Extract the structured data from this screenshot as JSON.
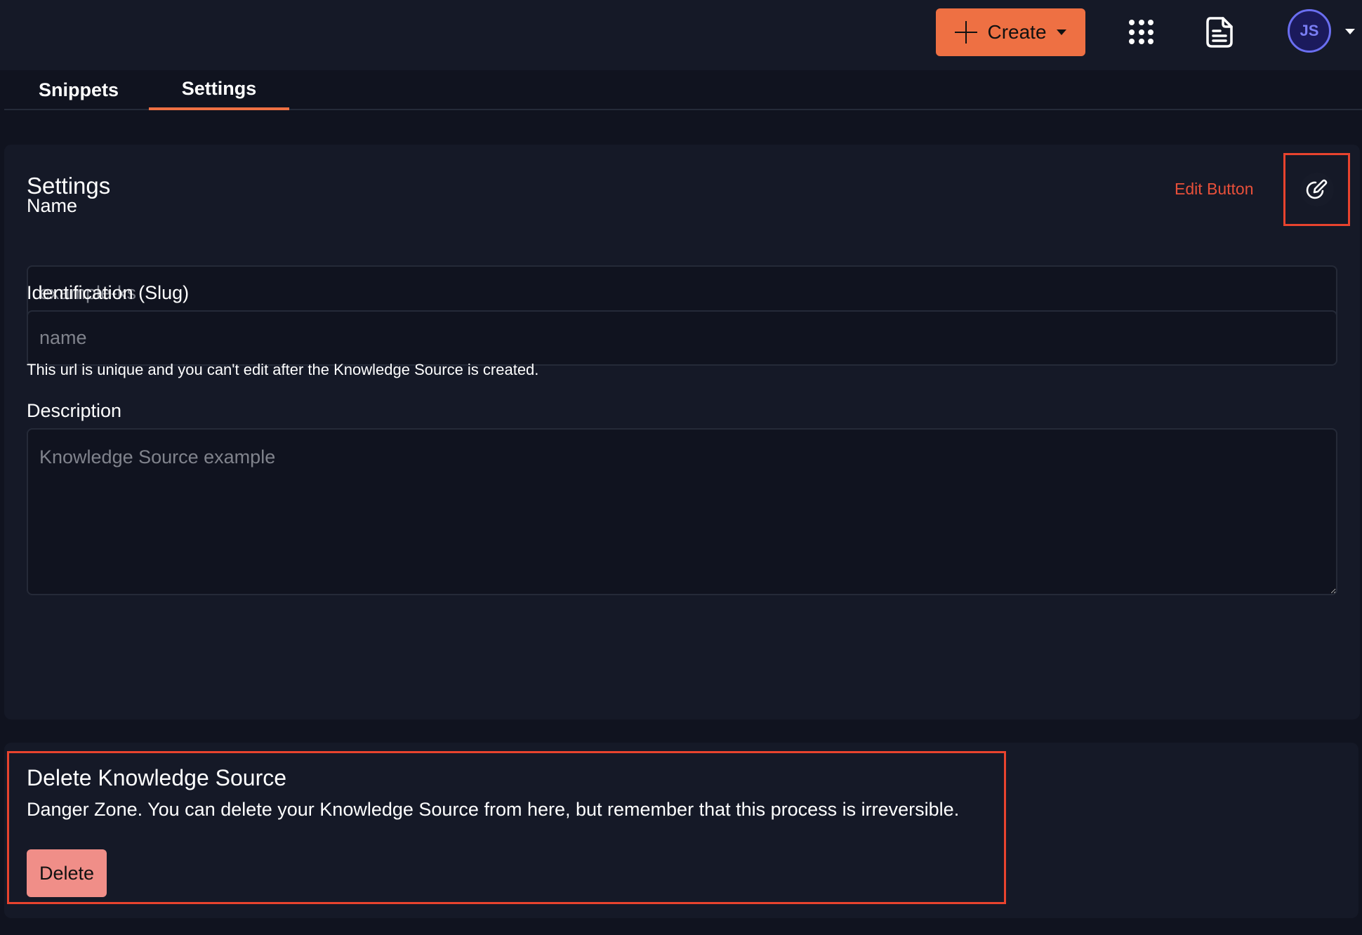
{
  "header": {
    "create_label": "Create",
    "avatar_initials": "JS",
    "icons": {
      "create": "plus-icon",
      "create_dropdown": "caret-down-icon",
      "apps": "apps-grid-icon",
      "docs": "document-icon",
      "user_menu": "caret-down-icon"
    }
  },
  "tabs": [
    {
      "label": "Snippets",
      "active": false
    },
    {
      "label": "Settings",
      "active": true
    }
  ],
  "settings": {
    "title": "Settings",
    "edit_label": "Edit Button",
    "edit_icon": "edit-pencil-icon",
    "fields": {
      "name": {
        "label": "Name",
        "placeholder": "example-ks",
        "value": ""
      },
      "slug": {
        "label": "Identification (Slug)",
        "placeholder": "name",
        "value": "",
        "helper": "This url is unique and you can't edit after the Knowledge Source is created."
      },
      "description": {
        "label": "Description",
        "placeholder": "Knowledge Source example",
        "value": ""
      }
    }
  },
  "danger": {
    "title": "Delete Knowledge Source",
    "description": "Danger Zone. You can delete your Knowledge Source from here, but remember that this process is irreversible.",
    "delete_label": "Delete"
  },
  "colors": {
    "accent": "#ee7043",
    "highlight": "#e8432e",
    "delete_button": "#f08e88",
    "avatar_ring": "#6a6ef0",
    "background": "#10131f",
    "card": "#151927"
  }
}
